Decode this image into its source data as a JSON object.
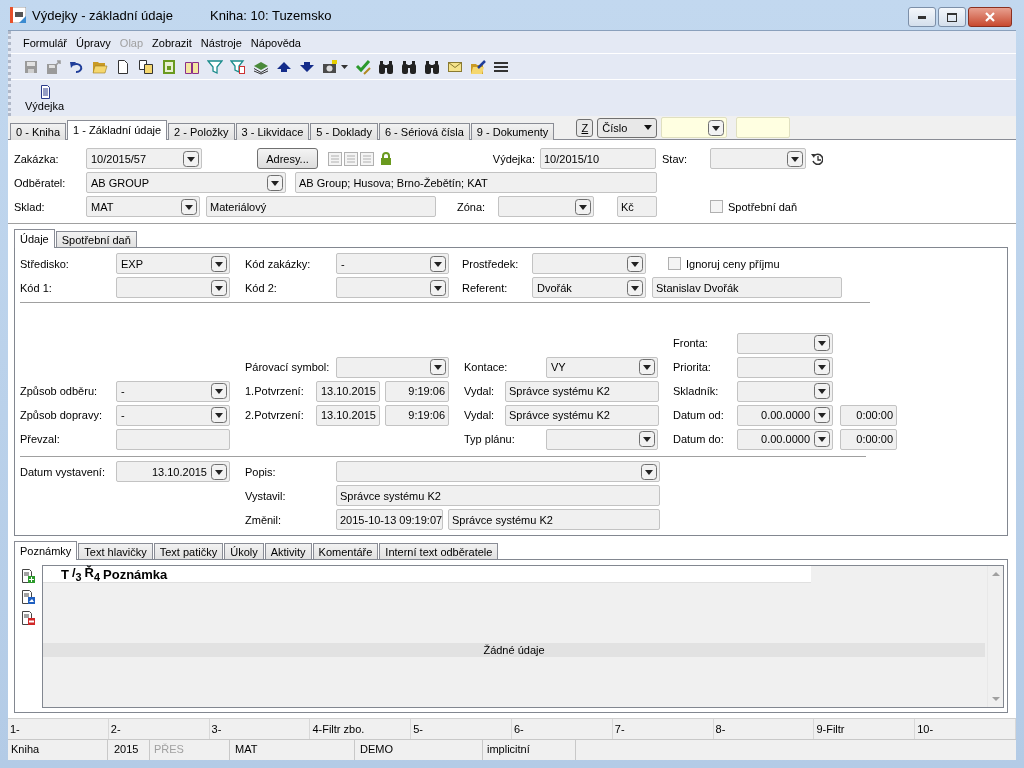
{
  "window": {
    "title": "Výdejky - základní údaje",
    "book": "Kniha: 10: Tuzemsko"
  },
  "menu": [
    {
      "label": "Formulář",
      "disabled": false
    },
    {
      "label": "Úpravy",
      "disabled": false
    },
    {
      "label": "Olap",
      "disabled": true
    },
    {
      "label": "Zobrazit",
      "disabled": false
    },
    {
      "label": "Nástroje",
      "disabled": false
    },
    {
      "label": "Nápověda",
      "disabled": false
    }
  ],
  "big_button": "Výdejka",
  "tabs": [
    {
      "label": "0 - Kniha",
      "selected": false
    },
    {
      "label": "1 - Základní údaje",
      "selected": true
    },
    {
      "label": "2 - Položky",
      "selected": false
    },
    {
      "label": "3 - Likvidace",
      "selected": false
    },
    {
      "label": "5 - Doklady",
      "selected": false
    },
    {
      "label": "6 - Sériová čísla",
      "selected": false
    },
    {
      "label": "9 - Dokumenty",
      "selected": false
    }
  ],
  "sort": {
    "button": "Z",
    "order": "Číslo"
  },
  "header": {
    "zakazka": {
      "label": "Zakázka:",
      "value": "10/2015/57"
    },
    "adresy_button": "Adresy...",
    "vydejka": {
      "label": "Výdejka:",
      "value": "10/2015/10"
    },
    "stav": {
      "label": "Stav:"
    },
    "odberatel": {
      "label": "Odběratel:",
      "value": "AB GROUP",
      "detail": "AB Group; Husova; Brno-Žebětín; KAT"
    },
    "sklad": {
      "label": "Sklad:",
      "value": "MAT",
      "detail": "Materiálový"
    },
    "zona": {
      "label": "Zóna:"
    },
    "currency": "Kč",
    "spotrebni_dan": {
      "label": "Spotřební daň",
      "checked": false
    }
  },
  "detail": {
    "tabs": [
      {
        "label": "Údaje",
        "selected": true
      },
      {
        "label": "Spotřební daň",
        "selected": false
      }
    ],
    "stredisko": {
      "label": "Středisko:",
      "value": "EXP"
    },
    "kod_zakazky": {
      "label": "Kód zakázky:",
      "value": "-"
    },
    "prostredek": {
      "label": "Prostředek:"
    },
    "ignoruj_ceny": {
      "label": "Ignoruj ceny příjmu",
      "checked": false
    },
    "kod_1": {
      "label": "Kód 1:"
    },
    "kod_2": {
      "label": "Kód 2:"
    },
    "referent": {
      "label": "Referent:",
      "value": "Dvořák",
      "detail": "Stanislav Dvořák"
    },
    "fronta": {
      "label": "Fronta:"
    },
    "parovaci_symbol": {
      "label": "Párovací symbol:"
    },
    "kontace": {
      "label": "Kontace:",
      "value": "VY"
    },
    "priorita": {
      "label": "Priorita:"
    },
    "zpusob_odberu": {
      "label": "Způsob odběru:",
      "value": "-"
    },
    "potvrzeni_1": {
      "label": "1.Potvrzení:",
      "date": "13.10.2015",
      "time": "9:19:06"
    },
    "vydal_1": {
      "label": "Vydal:",
      "value": "Správce systému K2"
    },
    "skladnik": {
      "label": "Skladník:"
    },
    "zpusob_dopravy": {
      "label": "Způsob dopravy:",
      "value": "-"
    },
    "potvrzeni_2": {
      "label": "2.Potvrzení:",
      "date": "13.10.2015",
      "time": "9:19:06"
    },
    "vydal_2": {
      "label": "Vydal:",
      "value": "Správce systému K2"
    },
    "datum_od": {
      "label": "Datum od:",
      "date": "0.00.0000",
      "time": "0:00:00"
    },
    "prevzal": {
      "label": "Převzal:"
    },
    "typ_planu": {
      "label": "Typ plánu:"
    },
    "datum_do": {
      "label": "Datum do:",
      "date": "0.00.0000",
      "time": "0:00:00"
    },
    "datum_vystaveni": {
      "label": "Datum vystavení:",
      "value": "13.10.2015"
    },
    "popis": {
      "label": "Popis:"
    },
    "vystavil": {
      "label": "Vystavil:",
      "value": "Správce systému K2"
    },
    "zmenil": {
      "label": "Změnil:",
      "date": "2015-10-13 09:19:07",
      "value": "Správce systému K2"
    }
  },
  "notes": {
    "tabs": [
      {
        "label": "Poznámky",
        "selected": true
      },
      {
        "label": "Text hlavičky",
        "selected": false
      },
      {
        "label": "Text patičky",
        "selected": false
      },
      {
        "label": "Úkoly",
        "selected": false
      },
      {
        "label": "Aktivity",
        "selected": false
      },
      {
        "label": "Komentáře",
        "selected": false
      },
      {
        "label": "Interní text odběratele",
        "selected": false
      }
    ],
    "columns": [
      "T",
      "/$_{3}$",
      "Ř$_{4}$",
      "Poznámka"
    ],
    "empty_message": "Žádné údaje"
  },
  "function_keys": [
    "1-",
    "2-",
    "3-",
    "4-Filtr zbo.",
    "5-",
    "6-",
    "7-",
    "8-",
    "9-Filtr",
    "10-"
  ],
  "status_bar": [
    {
      "text": "Kniha",
      "disabled": false
    },
    {
      "text": "2015",
      "disabled": false
    },
    {
      "text": "PŘES",
      "disabled": true
    },
    {
      "text": "MAT",
      "disabled": false
    },
    {
      "text": "DEMO",
      "disabled": false
    },
    {
      "text": "implicitní",
      "disabled": false
    }
  ]
}
